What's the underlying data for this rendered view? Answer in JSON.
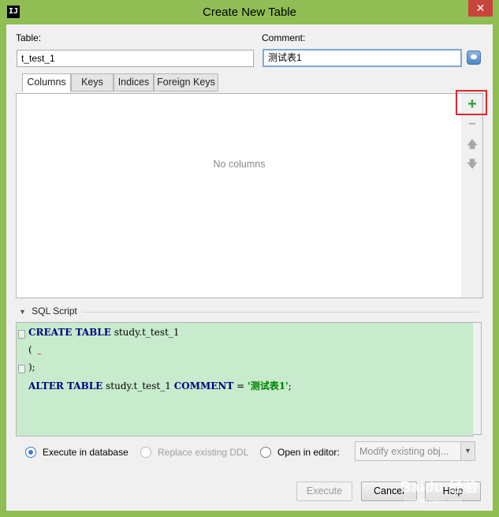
{
  "window": {
    "title": "Create New Table",
    "app_icon_text": "IJ",
    "close_symbol": "✕"
  },
  "form": {
    "table_label": "Table:",
    "table_value": "t_test_1",
    "comment_label": "Comment:",
    "comment_value": "测试表1"
  },
  "tabs": [
    {
      "label": "Columns",
      "active": true
    },
    {
      "label": "Keys",
      "active": false
    },
    {
      "label": "Indices",
      "active": false
    },
    {
      "label": "Foreign Keys",
      "active": false
    }
  ],
  "columns_panel": {
    "empty_text": "No columns",
    "toolbar": {
      "add": "+",
      "remove": "−",
      "up": "🡅",
      "down": "🡇"
    }
  },
  "sql_script": {
    "header": "SQL Script",
    "lines": [
      [
        {
          "t": "CREATE TABLE",
          "c": "kw"
        },
        {
          "t": " study.t_test_1",
          "c": ""
        }
      ],
      [
        {
          "t": "(",
          "c": ""
        }
      ],
      [
        {
          "t": ");",
          "c": ""
        }
      ],
      [
        {
          "t": "ALTER TABLE",
          "c": "kw"
        },
        {
          "t": " study.t_test_1 ",
          "c": ""
        },
        {
          "t": "COMMENT",
          "c": "kw"
        },
        {
          "t": " = ",
          "c": ""
        },
        {
          "t": "'测试表1'",
          "c": "str"
        },
        {
          "t": ";",
          "c": ""
        }
      ]
    ]
  },
  "options": {
    "execute_in_database": "Execute in database",
    "replace_existing_ddl": "Replace existing DDL",
    "open_in_editor": "Open in editor:",
    "editor_combo_value": "Modify existing obj..."
  },
  "buttons": {
    "execute": "Execute",
    "cancel": "Cancel",
    "help": "Help"
  },
  "watermark": {
    "main": "Baidu 经验",
    "sub": "jingyan.baidu.com"
  },
  "colors": {
    "title_bar": "#90bd54",
    "sql_background": "#c7ebcc",
    "keyword": "#000080",
    "string": "#008000",
    "add_icon": "#3a9a3a",
    "highlight_box": "#e0282e"
  }
}
